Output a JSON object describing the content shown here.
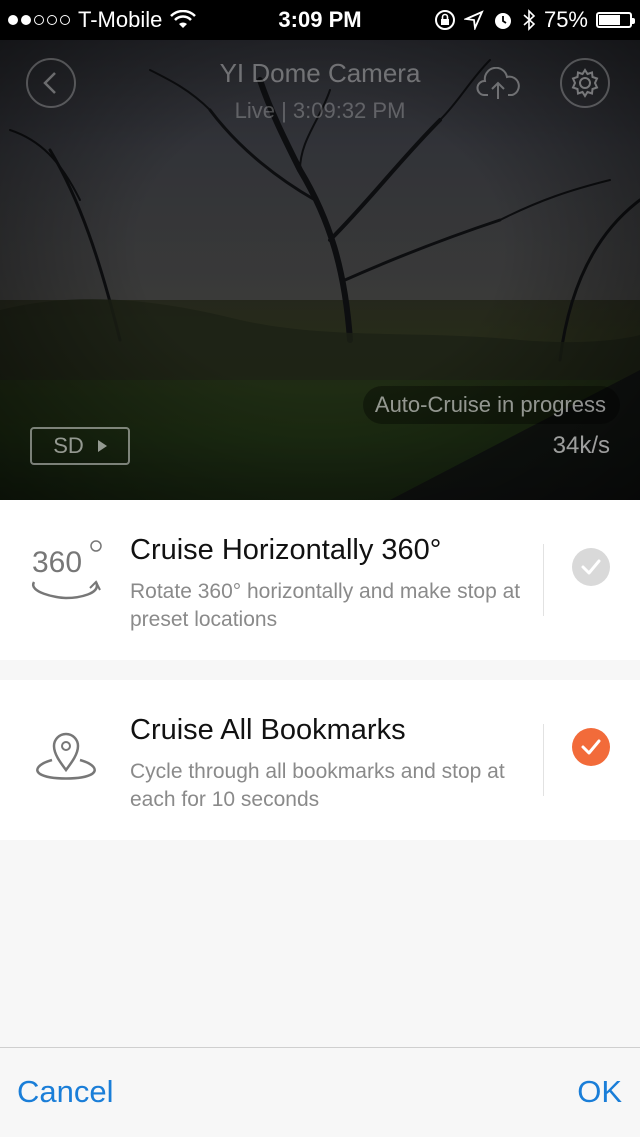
{
  "status_bar": {
    "carrier": "T-Mobile",
    "time": "3:09 PM",
    "battery": "75%",
    "battery_level": 0.75,
    "signal_bars": 2
  },
  "camera": {
    "title": "YI Dome Camera",
    "subtitle": "Live | 3:09:32 PM",
    "auto_cruise": "Auto-Cruise in progress",
    "quality": "SD",
    "speed": "34k/s"
  },
  "options": [
    {
      "icon": "360-icon",
      "icon_text": "360",
      "title": "Cruise Horizontally 360°",
      "description": "Rotate 360° horizontally and make stop at preset locations",
      "selected": false
    },
    {
      "icon": "location-pin-icon",
      "title": "Cruise All Bookmarks",
      "description": "Cycle through all bookmarks and stop at each for 10 seconds",
      "selected": true
    }
  ],
  "footer": {
    "cancel_label": "Cancel",
    "ok_label": "OK"
  },
  "colors": {
    "accent": "#1a7ed8",
    "selected": "#f26b3a",
    "unselected": "#d9d9d9"
  }
}
